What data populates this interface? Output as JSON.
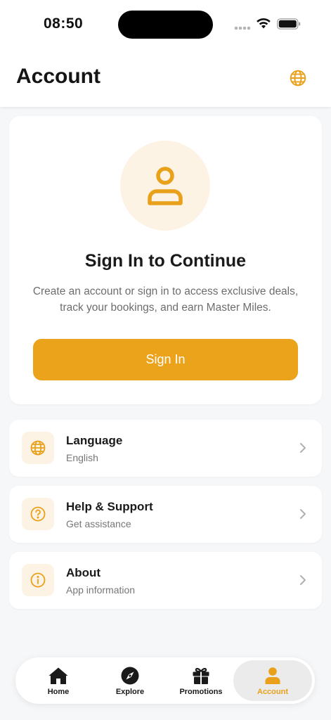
{
  "status_bar": {
    "time": "08:50"
  },
  "header": {
    "title": "Account"
  },
  "signin_card": {
    "title": "Sign In to Continue",
    "description": "Create an account or sign in to access exclusive deals, track your bookings, and earn Master Miles.",
    "button_label": "Sign In"
  },
  "menu": [
    {
      "title": "Language",
      "subtitle": "English",
      "icon": "globe-icon"
    },
    {
      "title": "Help & Support",
      "subtitle": "Get assistance",
      "icon": "question-circle-icon"
    },
    {
      "title": "About",
      "subtitle": "App information",
      "icon": "info-circle-icon"
    }
  ],
  "bottom_nav": [
    {
      "label": "Home",
      "icon": "home-icon"
    },
    {
      "label": "Explore",
      "icon": "compass-icon"
    },
    {
      "label": "Promotions",
      "icon": "gift-icon"
    },
    {
      "label": "Account",
      "icon": "person-icon",
      "active": true
    }
  ],
  "colors": {
    "accent": "#eba31b",
    "accent_soft": "#fdf3e4",
    "background": "#f6f7f9"
  }
}
